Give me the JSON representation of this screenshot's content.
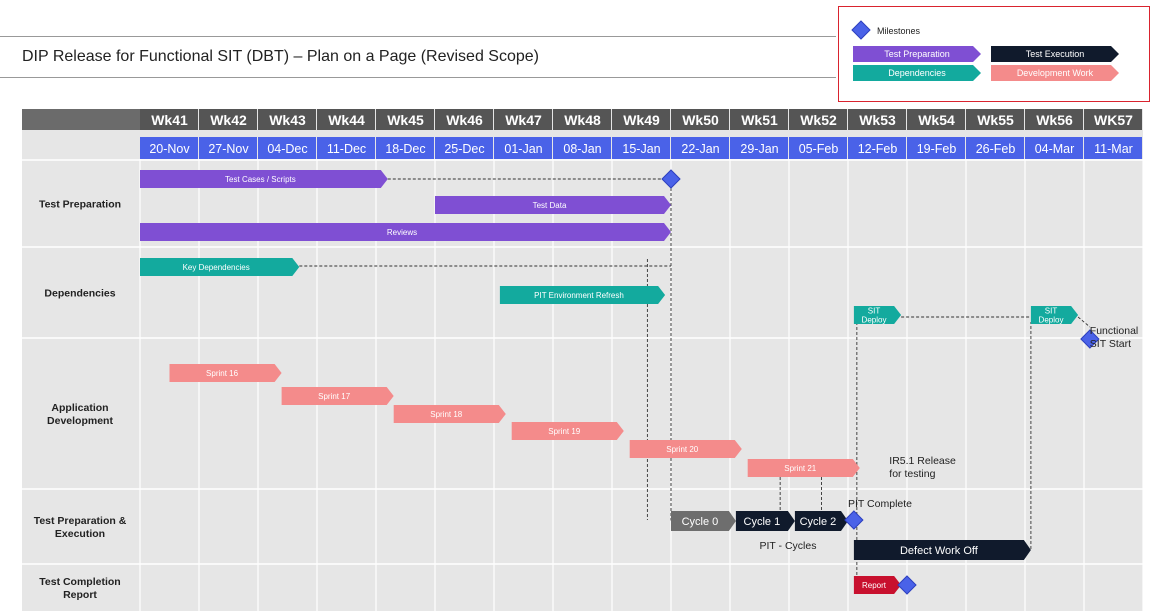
{
  "title": "DIP Release for Functional SIT (DBT) – Plan on a Page (Revised Scope)",
  "legend": {
    "milestones": "Milestones",
    "test_preparation": "Test Preparation",
    "test_execution": "Test Execution",
    "dependencies": "Dependencies",
    "development_work": "Development Work"
  },
  "colors": {
    "test_preparation": "#7f4fd3",
    "dependencies": "#13aa9e",
    "development_work": "#f48b8b",
    "test_execution": "#101a2c",
    "cycle0": "#6e6e6e",
    "report": "#c8102e",
    "milestone": "#4a62e8",
    "week_header": "#555555",
    "date_header": "#4a62e8",
    "grid_bg": "#e6e6e6"
  },
  "chart_data": {
    "type": "gantt",
    "weeks": [
      "Wk41",
      "Wk42",
      "Wk43",
      "Wk44",
      "Wk45",
      "Wk46",
      "Wk47",
      "Wk48",
      "Wk49",
      "Wk50",
      "Wk51",
      "Wk52",
      "Wk53",
      "Wk54",
      "Wk55",
      "Wk56",
      "WK57"
    ],
    "dates": [
      "20-Nov",
      "27-Nov",
      "04-Dec",
      "11-Dec",
      "18-Dec",
      "25-Dec",
      "01-Jan",
      "08-Jan",
      "15-Jan",
      "22-Jan",
      "29-Jan",
      "05-Feb",
      "12-Feb",
      "19-Feb",
      "26-Feb",
      "04-Mar",
      "11-Mar"
    ],
    "lanes": [
      {
        "name": "Test Preparation",
        "label_lines": [
          "Test Preparation"
        ]
      },
      {
        "name": "Dependencies",
        "label_lines": [
          "Dependencies"
        ]
      },
      {
        "name": "Application Development",
        "label_lines": [
          "Application",
          "Development"
        ]
      },
      {
        "name": "Test Preparation & Execution",
        "label_lines": [
          "Test Preparation &",
          "Execution"
        ]
      },
      {
        "name": "Test Completion Report",
        "label_lines": [
          "Test Completion",
          "Report"
        ]
      }
    ],
    "tasks": [
      {
        "label": "Test Cases / Scripts",
        "lines": [
          "Test Cases / Scripts"
        ],
        "category": "test_preparation",
        "lane": 0,
        "row": 0,
        "start": 0,
        "end": 4.2
      },
      {
        "label": "Test Data",
        "lines": [
          "Test Data"
        ],
        "category": "test_preparation",
        "lane": 0,
        "row": 1,
        "start": 5,
        "end": 9
      },
      {
        "label": "Reviews",
        "lines": [
          "Reviews"
        ],
        "category": "test_preparation",
        "lane": 0,
        "row": 2,
        "start": 0,
        "end": 9
      },
      {
        "label": "Key Dependencies",
        "lines": [
          "Key Dependencies"
        ],
        "category": "dependencies",
        "lane": 1,
        "row": 0,
        "start": 0,
        "end": 2.7
      },
      {
        "label": "PIT Environment Refresh",
        "lines": [
          "PIT Environment Refresh"
        ],
        "category": "dependencies",
        "lane": 1,
        "row": 1,
        "start": 6.1,
        "end": 8.9
      },
      {
        "label": "SIT Deploy",
        "lines": [
          "SIT",
          "Deploy"
        ],
        "category": "dependencies",
        "lane": 1,
        "row": 2,
        "start": 12.1,
        "end": 12.9
      },
      {
        "label": "SIT Deploy",
        "lines": [
          "SIT",
          "Deploy"
        ],
        "category": "dependencies",
        "lane": 1,
        "row": 2,
        "start": 15.1,
        "end": 15.9
      },
      {
        "label": "Sprint 16",
        "lines": [
          "Sprint 16"
        ],
        "category": "development_work",
        "lane": 2,
        "row": 0,
        "start": 0.5,
        "end": 2.4
      },
      {
        "label": "Sprint 17",
        "lines": [
          "Sprint 17"
        ],
        "category": "development_work",
        "lane": 2,
        "row": 1,
        "start": 2.4,
        "end": 4.3
      },
      {
        "label": "Sprint 18",
        "lines": [
          "Sprint 18"
        ],
        "category": "development_work",
        "lane": 2,
        "row": 2,
        "start": 4.3,
        "end": 6.2
      },
      {
        "label": "Sprint 19",
        "lines": [
          "Sprint 19"
        ],
        "category": "development_work",
        "lane": 2,
        "row": 3,
        "start": 6.3,
        "end": 8.2
      },
      {
        "label": "Sprint 20",
        "lines": [
          "Sprint 20"
        ],
        "category": "development_work",
        "lane": 2,
        "row": 4,
        "start": 8.3,
        "end": 10.2
      },
      {
        "label": "Sprint 21",
        "lines": [
          "Sprint 21"
        ],
        "category": "development_work",
        "lane": 2,
        "row": 5,
        "start": 10.3,
        "end": 12.2
      },
      {
        "label": "Cycle 0",
        "lines": [
          "Cycle 0"
        ],
        "category": "cycle0",
        "lane": 3,
        "row": 0,
        "start": 9,
        "end": 10.1
      },
      {
        "label": "Cycle 1",
        "lines": [
          "Cycle 1"
        ],
        "category": "test_execution",
        "lane": 3,
        "row": 0,
        "start": 10.1,
        "end": 11.1
      },
      {
        "label": "Cycle 2",
        "lines": [
          "Cycle 2"
        ],
        "category": "test_execution",
        "lane": 3,
        "row": 0,
        "start": 11.1,
        "end": 12
      },
      {
        "label": "Defect Work Off",
        "lines": [
          "Defect Work Off"
        ],
        "category": "test_execution",
        "lane": 3,
        "row": 1,
        "start": 12.1,
        "end": 15.1
      },
      {
        "label": "Report",
        "lines": [
          "Report"
        ],
        "category": "report",
        "lane": 4,
        "row": 0,
        "start": 12.1,
        "end": 12.9
      }
    ],
    "milestones": [
      {
        "lane": 0,
        "row": 0,
        "week": 9
      },
      {
        "lane": 1,
        "row": 3,
        "week": 16.1
      },
      {
        "lane": 3,
        "row": 0,
        "week": 12.1
      },
      {
        "lane": 4,
        "row": 0,
        "week": 13
      }
    ],
    "annotations": [
      {
        "lines": [
          "Functional",
          "SIT Start"
        ],
        "lane": 1,
        "row": 3,
        "week": 16.2
      },
      {
        "lines": [
          "IR5.1 Release",
          "for testing"
        ],
        "lane": 2,
        "row": 5,
        "week": 12.7
      },
      {
        "lines": [
          "PIT Complete"
        ],
        "lane": 3,
        "row": -1,
        "week": 12.0
      },
      {
        "lines": [
          "PIT - Cycles"
        ],
        "lane": 3,
        "row": 1,
        "week": 10.5
      }
    ]
  }
}
